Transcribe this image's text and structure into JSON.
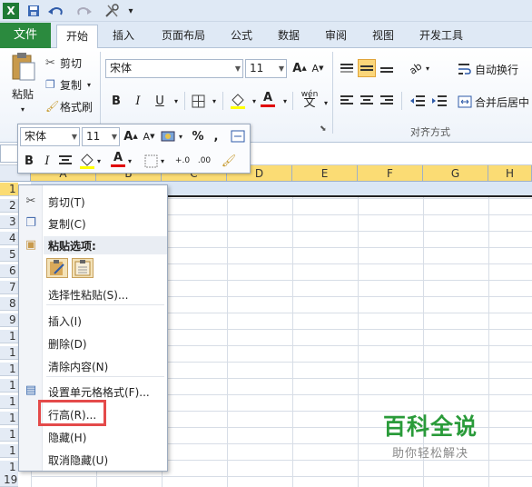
{
  "quick_access": {
    "excel_icon": "X",
    "customize_label": "▾"
  },
  "tabs": [
    "文件",
    "开始",
    "插入",
    "页面布局",
    "公式",
    "数据",
    "审阅",
    "视图",
    "开发工具"
  ],
  "clipboard": {
    "paste": "粘贴",
    "cut": "剪切",
    "copy": "复制",
    "format_painter": "格式刷"
  },
  "font": {
    "name": "宋体",
    "size": "11",
    "grow": "A",
    "shrink": "A",
    "bold": "B",
    "italic": "I",
    "underline": "U",
    "wen": "wén",
    "font_color_label": "A"
  },
  "alignment": {
    "wrap": "自动换行",
    "merge": "合并后居中",
    "group_label": "对齐方式"
  },
  "mini_toolbar": {
    "font": "宋体",
    "size": "11",
    "bold": "B",
    "italic": "I",
    "percent": "%",
    "comma": ",",
    "font_color": "A"
  },
  "columns": [
    "A",
    "B",
    "C",
    "D",
    "E",
    "F",
    "G",
    "H"
  ],
  "rows": [
    "1",
    "2",
    "3",
    "4",
    "5",
    "6",
    "7",
    "8",
    "9",
    "1",
    "1",
    "1",
    "1",
    "1",
    "1",
    "1",
    "1",
    "1",
    "19"
  ],
  "context_menu": {
    "cut": "剪切(T)",
    "copy": "复制(C)",
    "paste_options": "粘贴选项:",
    "paste_special": "选择性粘贴(S)...",
    "insert": "插入(I)",
    "delete": "删除(D)",
    "clear": "清除内容(N)",
    "format_cells": "设置单元格格式(F)...",
    "row_height": "行高(R)...",
    "hide": "隐藏(H)",
    "unhide": "取消隐藏(U)"
  },
  "watermark": {
    "title": "百科全说",
    "subtitle": "助你轻松解决"
  },
  "colors": {
    "file_tab": "#2b8a3e",
    "header_selected": "#fbdc74",
    "highlight": "#e44a4a",
    "watermark": "#2a9b3a"
  }
}
